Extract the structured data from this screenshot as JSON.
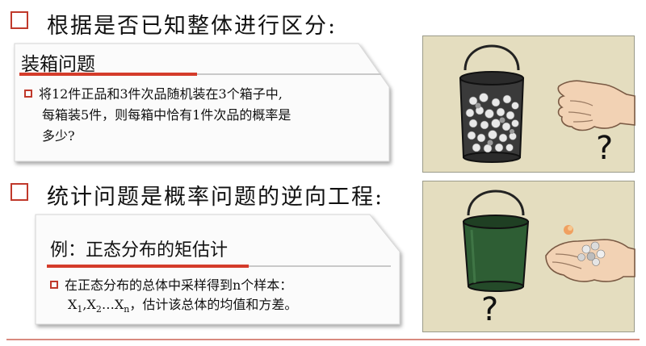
{
  "section1": {
    "heading": "根据是否已知整体进行区分:",
    "card_title": "装箱问题",
    "problem_lines": [
      "将12件正品和3件次品随机装在3个箱子中,",
      "每箱装5件，则每箱中恰有1件次品的概率是",
      "多少?"
    ],
    "question_mark": "?"
  },
  "section2": {
    "heading": "统计问题是概率问题的逆向工程:",
    "card_title": "例：正态分布的矩估计",
    "problem_line1": "在正态分布的总体中采样得到n个样本：",
    "problem_line2_prefix": "X",
    "sub1": "1",
    "sep1": ",X",
    "sub2": "2",
    "sep2": "…X",
    "subn": "n",
    "problem_line2_suffix": "，估计该总体的均值和方差。",
    "question_mark": "?"
  },
  "colors": {
    "accent_red": "#c0392b",
    "panel_bg": "#e4ddbf",
    "bucket1_contents": "#3a3a3a",
    "bucket2_body": "#2e5e34"
  },
  "icons": {
    "bucket_with_balls": "bucket-full-icon",
    "open_hand": "hand-icon",
    "bucket_green": "bucket-green-icon",
    "hand_holding_balls": "hand-with-balls-icon"
  }
}
